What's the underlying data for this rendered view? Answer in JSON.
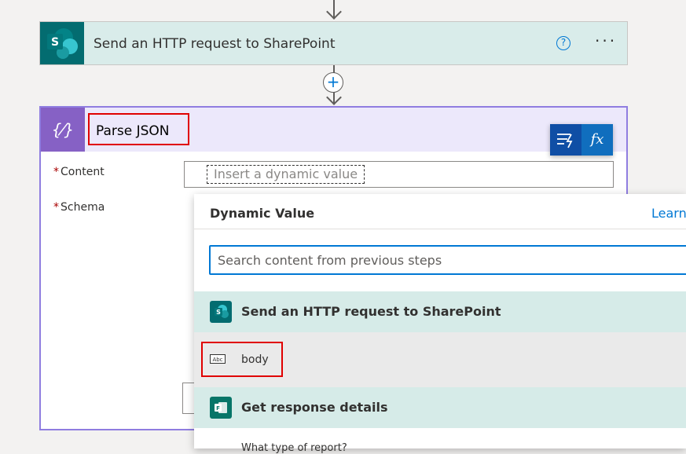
{
  "http_action": {
    "title": "Send an HTTP request to SharePoint",
    "help_icon": "?",
    "more_icon": "···"
  },
  "add_step": {
    "icon": "+"
  },
  "parse_action": {
    "title": "Parse JSON",
    "icon": "{⁄}",
    "content_label": "Content",
    "schema_label": "Schema",
    "required_mark": "*",
    "content_placeholder": "Insert a dynamic value"
  },
  "toolbar": {
    "dynamic_icon": "⚡",
    "fx_label": "fx"
  },
  "dynamic_panel": {
    "title": "Dynamic Value",
    "learn_link": "Learn",
    "search_placeholder": "Search content from previous steps",
    "groups": [
      {
        "title": "Send an HTTP request to SharePoint",
        "items": [
          {
            "icon_text": "Abc",
            "label": "body"
          }
        ]
      },
      {
        "title": "Get response details",
        "items": [
          {
            "label": "What type of report?"
          }
        ]
      }
    ]
  },
  "colors": {
    "accent": "#0078d4",
    "sharepoint": "#036c70",
    "parse_json": "#8661c5",
    "highlight": "#e00000"
  }
}
